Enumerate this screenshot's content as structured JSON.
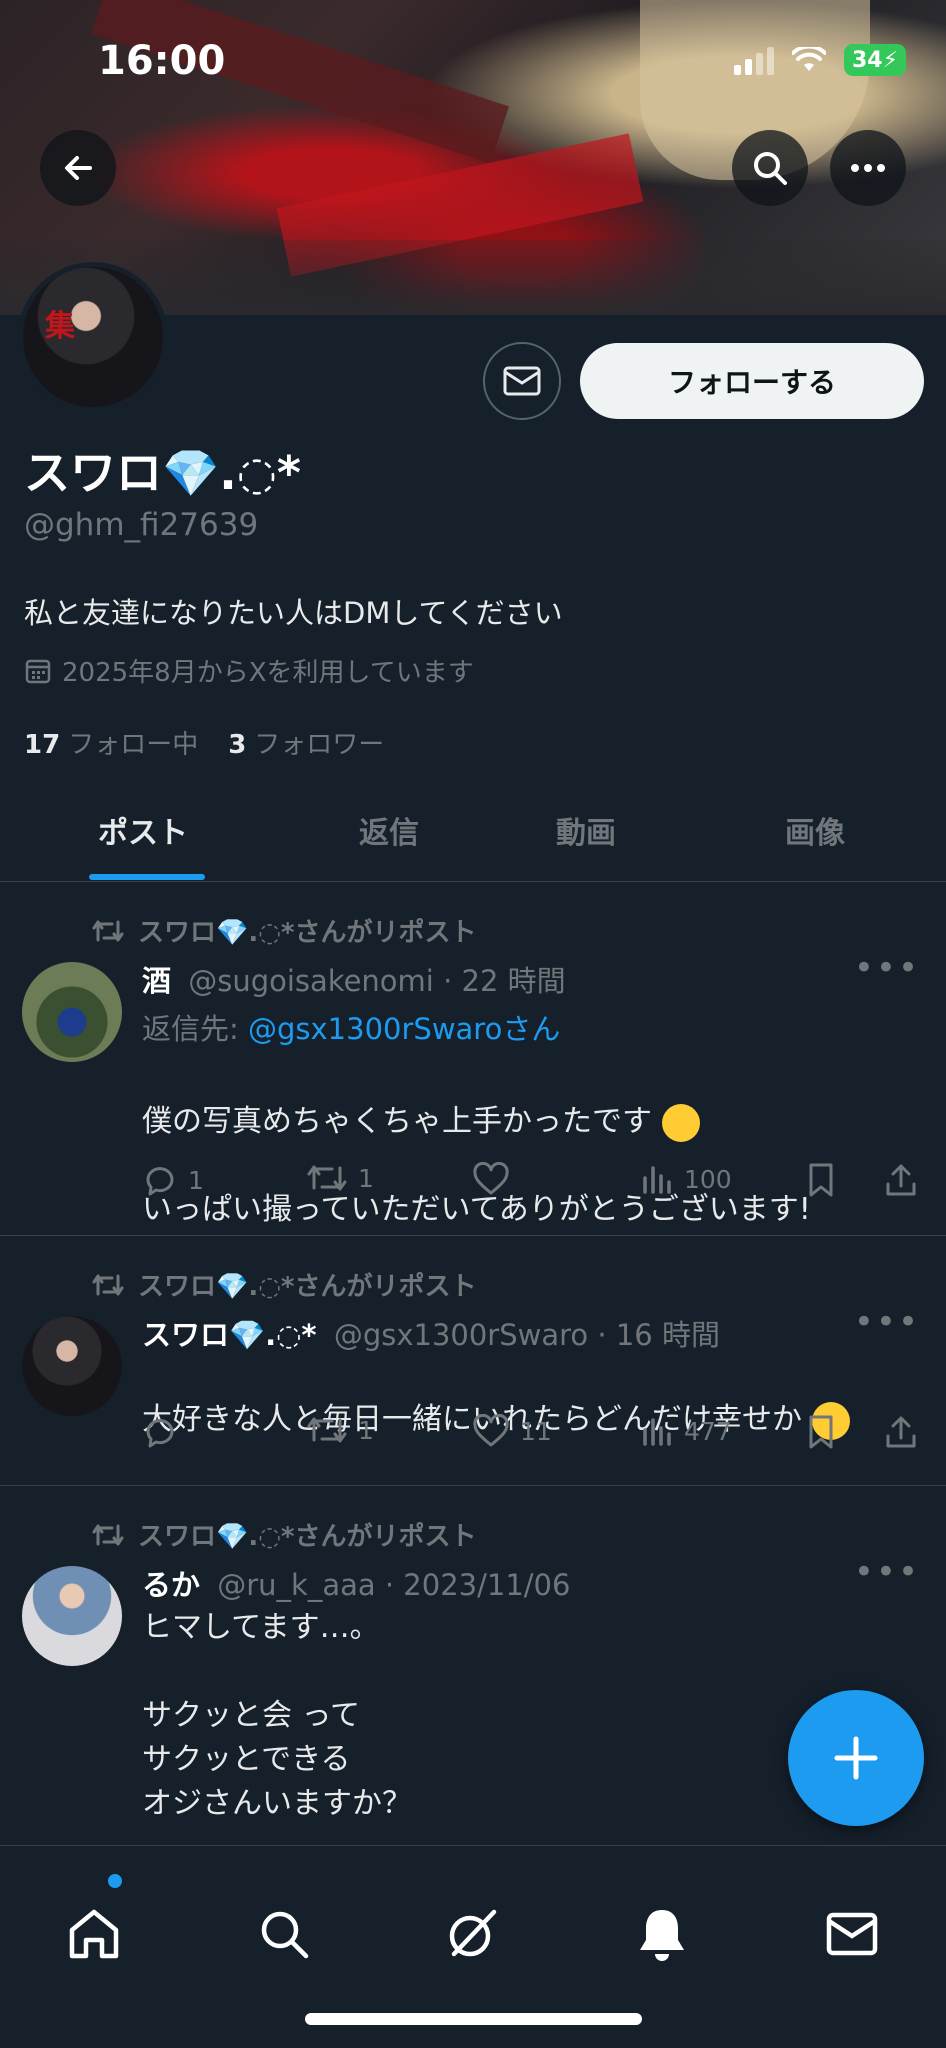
{
  "status_bar": {
    "time": "16:00",
    "battery": "34"
  },
  "profile": {
    "display_name": "スワロ💎.◌*",
    "handle": "@ghm_fi27639",
    "bio": "私と友達になりたい人はDMしてください",
    "joined": "2025年8月からXを利用しています",
    "following_count": "17",
    "following_label": "フォロー中",
    "followers_count": "3",
    "followers_label": "フォロワー",
    "follow_button": "フォローする"
  },
  "tabs": [
    {
      "label": "ポスト",
      "active": true
    },
    {
      "label": "返信",
      "active": false
    },
    {
      "label": "動画",
      "active": false
    },
    {
      "label": "画像",
      "active": false
    }
  ],
  "posts": [
    {
      "repost_text": "スワロ💎.◌*さんがリポスト",
      "name": "酒",
      "handle": "@sugoisakenomi",
      "time": "· 22 時間",
      "reply_prefix": "返信先: ",
      "reply_target": "@gsx1300rSwaroさん",
      "text_line1": "僕の写真めちゃくちゃ上手かったです",
      "text_line2": "いっぱい撮っていただいてありがとうございます!",
      "replies": "1",
      "reposts": "1",
      "likes": "",
      "views": "100"
    },
    {
      "repost_text": "スワロ💎.◌*さんがリポスト",
      "name": "スワロ💎.◌*",
      "handle": "@gsx1300rSwaro",
      "time": "· 16 時間",
      "text_line1": "大好きな人と毎日一緒にいれたらどんだけ幸せか",
      "replies": "",
      "reposts": "1",
      "likes": "11",
      "views": "477"
    },
    {
      "repost_text": "スワロ💎.◌*さんがリポスト",
      "name": "るか",
      "handle": "@ru_k_aaa",
      "time": "· 2023/11/06",
      "text": "ヒマしてます…。\n\nサクッと会 って\nサクッとできる\nオジさんいますか？"
    }
  ],
  "icons": {
    "back": "back-arrow-icon",
    "search": "search-icon",
    "more": "more-icon",
    "mail": "mail-icon",
    "calendar": "calendar-icon",
    "retweet": "retweet-icon",
    "reply": "reply-icon",
    "like": "heart-icon",
    "views": "views-icon",
    "bookmark": "bookmark-icon",
    "share": "share-icon"
  },
  "colors": {
    "accent": "#1d9bf0",
    "background": "#15202b",
    "muted": "#71767b"
  }
}
